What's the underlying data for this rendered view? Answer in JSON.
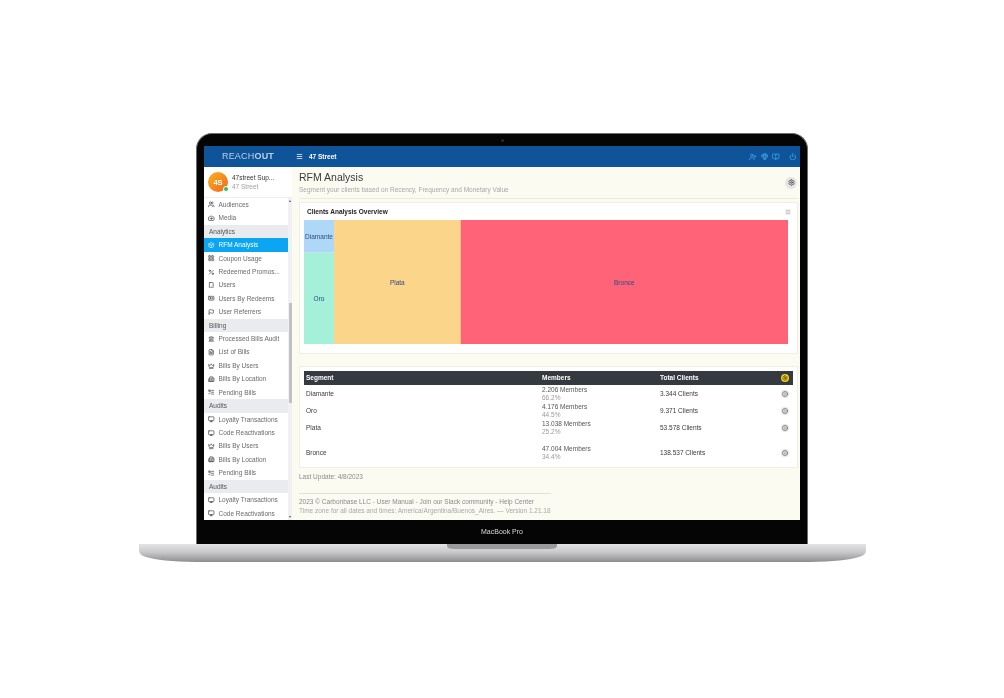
{
  "device": {
    "label": "MacBook Pro"
  },
  "header": {
    "logo": "REACH**OUT**",
    "location": "47 Street"
  },
  "profile": {
    "initials": "4S",
    "name": "47street Sup...",
    "subtitle": "47 Street",
    "online": true
  },
  "sidebar": {
    "items": [
      {
        "kind": "item",
        "label": "Audiences",
        "selected": false
      },
      {
        "kind": "item",
        "label": "Media",
        "selected": false
      },
      {
        "kind": "header",
        "label": "Analytics"
      },
      {
        "kind": "item",
        "label": "RFM Analysis",
        "selected": true
      },
      {
        "kind": "item",
        "label": "Coupon Usage",
        "selected": false
      },
      {
        "kind": "item",
        "label": "Redeemed Promos...",
        "selected": false
      },
      {
        "kind": "item",
        "label": "Users",
        "selected": false
      },
      {
        "kind": "item",
        "label": "Users By Redeems",
        "selected": false
      },
      {
        "kind": "item",
        "label": "User Referrers",
        "selected": false
      },
      {
        "kind": "header",
        "label": "Billing"
      },
      {
        "kind": "item",
        "label": "Processed Bills Audit",
        "selected": false
      },
      {
        "kind": "item",
        "label": "List of Bills",
        "selected": false
      },
      {
        "kind": "item",
        "label": "Bills By Users",
        "selected": false
      },
      {
        "kind": "item",
        "label": "Bills By Location",
        "selected": false
      },
      {
        "kind": "item",
        "label": "Pending Bills",
        "selected": false
      },
      {
        "kind": "header",
        "label": "Audits"
      },
      {
        "kind": "item",
        "label": "Loyalty Transactions",
        "selected": false
      },
      {
        "kind": "item",
        "label": "Code Reactivations",
        "selected": false
      },
      {
        "kind": "item",
        "label": "Bills By Users",
        "selected": false
      },
      {
        "kind": "item",
        "label": "Bills By Location",
        "selected": false
      },
      {
        "kind": "item",
        "label": "Pending Bills",
        "selected": false
      },
      {
        "kind": "header",
        "label": "Audits"
      },
      {
        "kind": "item",
        "label": "Loyalty Transactions",
        "selected": false
      },
      {
        "kind": "item",
        "label": "Code Reactivations",
        "selected": false
      }
    ]
  },
  "page": {
    "title": "RFM Analysis",
    "subtitle": "Segment your clients based on Recency, Frequency and Monetary Value"
  },
  "overview": {
    "title": "Clients Analysis Overview",
    "tiles": [
      {
        "label": "Diamante",
        "color": "#afd8f8"
      },
      {
        "label": "Oro",
        "color": "#a4f0d9"
      },
      {
        "label": "Plata",
        "color": "#fbd58a"
      },
      {
        "label": "Bronce",
        "color": "#fe6378"
      }
    ]
  },
  "table": {
    "columns": [
      "Segment",
      "Members",
      "Total Clients"
    ],
    "rows": [
      {
        "segment": "Diamante",
        "members": "2.206 Members",
        "share": "66.2%",
        "total_clients": "3.344 Clients"
      },
      {
        "segment": "Oro",
        "members": "4.176 Members",
        "share": "44.5%",
        "total_clients": "9.371 Clients"
      },
      {
        "segment": "Plata",
        "members": "13.038 Members",
        "share": "25.2%",
        "total_clients": "53.578 Clients"
      },
      {
        "segment": "Bronce",
        "members": "47.004 Members",
        "share": "34.4%",
        "total_clients": "138.537 Clients"
      }
    ]
  },
  "last_update": "Last Update: 4/8/2023",
  "footer": {
    "credits": "2023 © Carbonbase LLC - User Manual - Join our Slack community - Help Center",
    "note": "Time zone for all dates and times: America/Argentina/Buenos_Aires. — Version 1.21.18"
  }
}
